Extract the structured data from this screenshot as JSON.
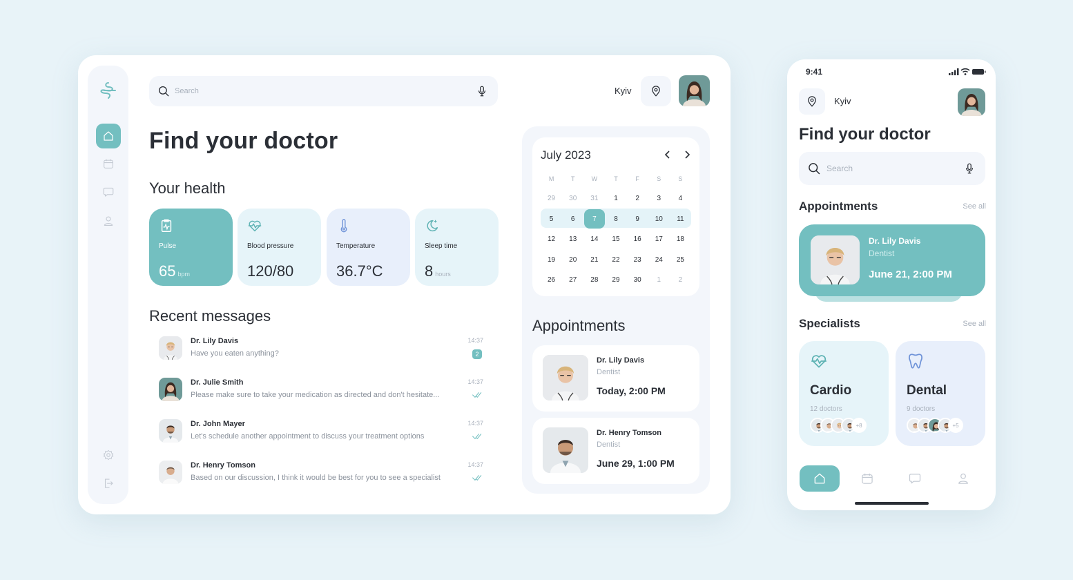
{
  "colors": {
    "accent": "#73bfc0",
    "text": "#2b2f36",
    "muted": "#a9b1bc",
    "panel": "#f3f6fb",
    "bg": "#e8f3f8"
  },
  "desktop": {
    "sidebar": {
      "logo": "app-logo-icon",
      "items": [
        {
          "name": "home",
          "icon": "home-icon",
          "active": true
        },
        {
          "name": "calendar",
          "icon": "calendar-icon",
          "active": false
        },
        {
          "name": "messages",
          "icon": "chat-icon",
          "active": false
        },
        {
          "name": "profile",
          "icon": "user-icon",
          "active": false
        }
      ],
      "bottom": [
        {
          "name": "settings",
          "icon": "gear-icon"
        },
        {
          "name": "logout",
          "icon": "logout-icon"
        }
      ]
    },
    "search": {
      "placeholder": "Search",
      "icon": "search-icon",
      "voice_icon": "microphone-icon"
    },
    "header": {
      "city": "Kyiv",
      "location_icon": "location-pin-icon"
    },
    "title": "Find your doctor",
    "health": {
      "title": "Your health",
      "metrics": [
        {
          "label": "Pulse",
          "value": "65",
          "unit": "bpm",
          "icon": "clipboard-pulse-icon"
        },
        {
          "label": "Blood pressure",
          "value": "120/80",
          "unit": "",
          "icon": "heart-pulse-icon"
        },
        {
          "label": "Temperature",
          "value": "36.7°C",
          "unit": "",
          "icon": "thermometer-icon"
        },
        {
          "label": "Sleep time",
          "value": "8",
          "unit": "hours",
          "icon": "moon-stars-icon"
        }
      ]
    },
    "messages": {
      "title": "Recent messages",
      "items": [
        {
          "name": "Dr. Lily Davis",
          "text": "Have you eaten anything?",
          "time": "14:37",
          "unread": "2"
        },
        {
          "name": "Dr. Julie Smith",
          "text": "Please make sure to take your medication as directed and don't hesitate...",
          "time": "14:37",
          "status": "read"
        },
        {
          "name": "Dr. John Mayer",
          "text": "Let's schedule another appointment to discuss your treatment options",
          "time": "14:37",
          "status": "read"
        },
        {
          "name": "Dr. Henry Tomson",
          "text": "Based on our discussion, I think it would be best for you to see a specialist",
          "time": "14:37",
          "status": "read"
        }
      ]
    },
    "calendar": {
      "month": "July 2023",
      "weekdays": [
        "M",
        "T",
        "W",
        "T",
        "F",
        "S",
        "S"
      ],
      "selected": "7",
      "weeks": [
        [
          "29",
          "30",
          "31",
          "1",
          "2",
          "3",
          "4"
        ],
        [
          "5",
          "6",
          "7",
          "8",
          "9",
          "10",
          "11"
        ],
        [
          "12",
          "13",
          "14",
          "15",
          "16",
          "17",
          "18"
        ],
        [
          "19",
          "20",
          "21",
          "22",
          "23",
          "24",
          "25"
        ],
        [
          "26",
          "27",
          "28",
          "29",
          "30",
          "1",
          "2"
        ]
      ]
    },
    "appointments": {
      "title": "Appointments",
      "items": [
        {
          "name": "Dr. Lily Davis",
          "specialty": "Dentist",
          "when": "Today, 2:00 PM"
        },
        {
          "name": "Dr. Henry Tomson",
          "specialty": "Dentist",
          "when": "June 29, 1:00 PM"
        }
      ]
    }
  },
  "mobile": {
    "status_time": "9:41",
    "city": "Kyiv",
    "title": "Find your doctor",
    "search_placeholder": "Search",
    "appointments": {
      "title": "Appointments",
      "see_all": "See all",
      "card": {
        "name": "Dr. Lily Davis",
        "specialty": "Dentist",
        "when": "June 21, 2:00 PM"
      }
    },
    "specialists": {
      "title": "Specialists",
      "see_all": "See all",
      "items": [
        {
          "title": "Cardio",
          "count": "12 doctors",
          "more": "+8",
          "icon": "heart-pulse-icon"
        },
        {
          "title": "Dental",
          "count": "9 doctors",
          "more": "+5",
          "icon": "tooth-icon"
        }
      ]
    },
    "tabs": [
      {
        "name": "home",
        "icon": "home-icon",
        "active": true
      },
      {
        "name": "calendar",
        "icon": "calendar-icon"
      },
      {
        "name": "messages",
        "icon": "chat-icon"
      },
      {
        "name": "profile",
        "icon": "user-icon"
      }
    ]
  }
}
